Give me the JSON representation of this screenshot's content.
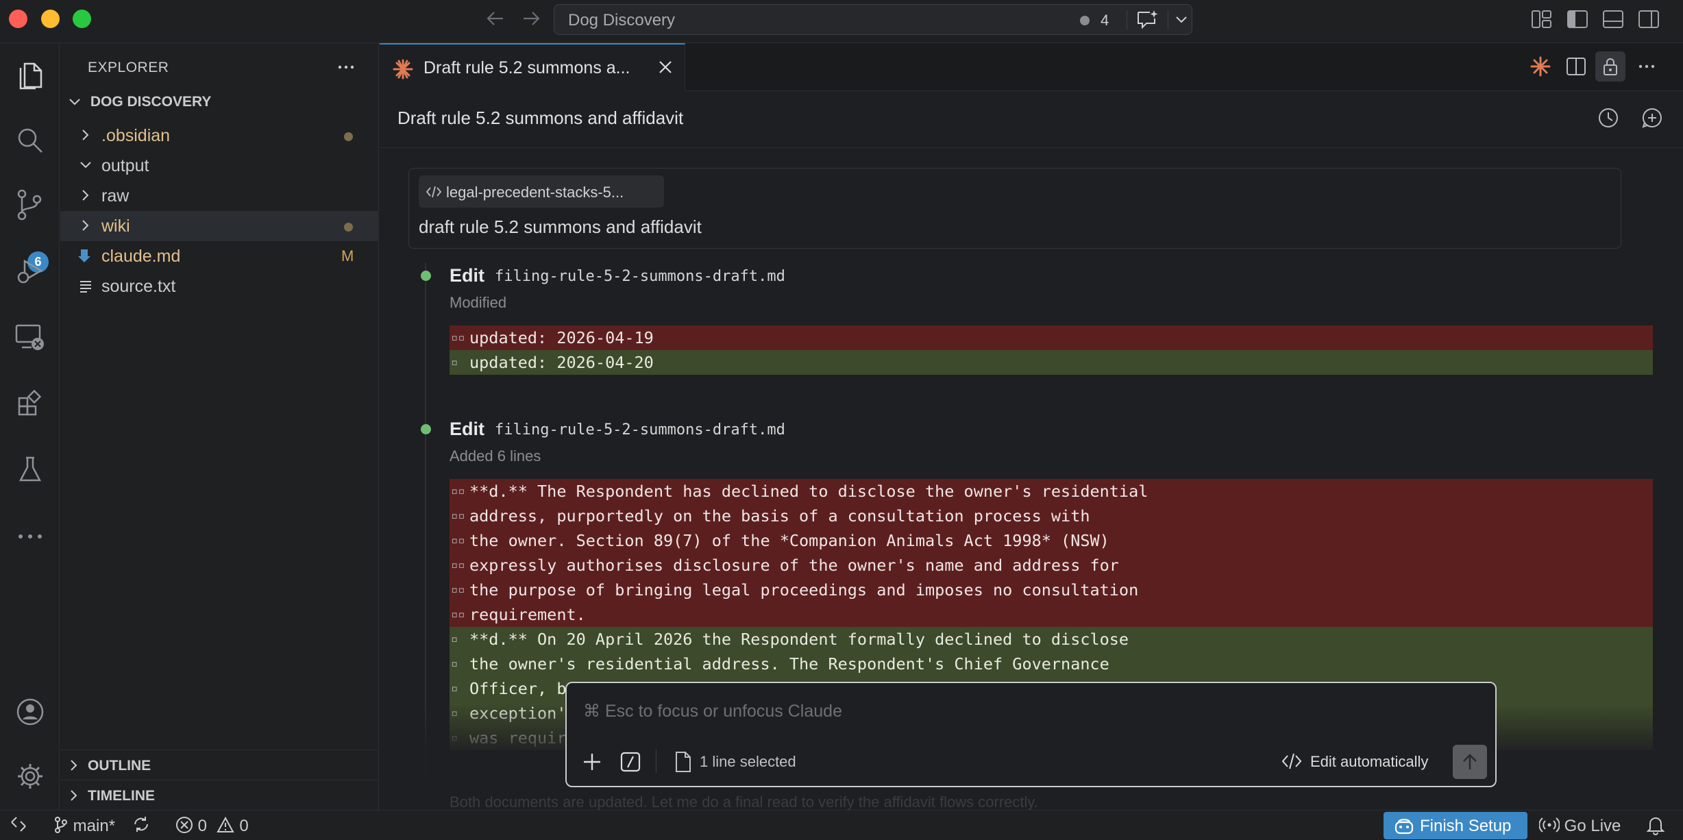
{
  "window": {
    "title": "Dog Discovery",
    "pending_count": "4"
  },
  "explorer": {
    "title": "EXPLORER",
    "workspace": "DOG DISCOVERY",
    "items": [
      {
        "label": ".obsidian",
        "type": "folder",
        "expanded": false,
        "color": "#e2c08d",
        "marker": "dot"
      },
      {
        "label": "output",
        "type": "folder",
        "expanded": true,
        "color": "#cccccc",
        "marker": ""
      },
      {
        "label": "raw",
        "type": "folder",
        "expanded": false,
        "color": "#cccccc",
        "marker": ""
      },
      {
        "label": "wiki",
        "type": "folder",
        "expanded": false,
        "color": "#e2c08d",
        "marker": "dot"
      },
      {
        "label": "claude.md",
        "type": "file",
        "color": "#e2c08d",
        "marker": "M"
      },
      {
        "label": "source.txt",
        "type": "file",
        "color": "#cccccc",
        "marker": ""
      }
    ],
    "outline_label": "OUTLINE",
    "timeline_label": "TIMELINE"
  },
  "activity_badge": "6",
  "tab": {
    "label": "Draft rule 5.2 summons a..."
  },
  "panel": {
    "title": "Draft rule 5.2 summons and affidavit",
    "context_chip": "legal-precedent-stacks-5...",
    "prompt": "draft rule 5.2 summons and affidavit"
  },
  "edits": [
    {
      "title": "Edit",
      "file": "filing-rule-5-2-summons-draft.md",
      "summary": "Modified",
      "lines": [
        {
          "kind": "del",
          "gutter": "▫▫",
          "text": "updated: 2026-04-19"
        },
        {
          "kind": "add",
          "gutter": "▫",
          "text": "updated: 2026-04-20"
        }
      ]
    },
    {
      "title": "Edit",
      "file": "filing-rule-5-2-summons-draft.md",
      "summary": "Added 6 lines",
      "lines": [
        {
          "kind": "del",
          "gutter": "▫▫",
          "text": "**d.** The Respondent has declined to disclose the owner's residential"
        },
        {
          "kind": "del",
          "gutter": "▫▫",
          "text": "address, purportedly on the basis of a consultation process with"
        },
        {
          "kind": "del",
          "gutter": "▫▫",
          "text": "the owner. Section 89(7) of the *Companion Animals Act 1998* (NSW)"
        },
        {
          "kind": "del",
          "gutter": "▫▫",
          "text": "expressly authorises disclosure of the owner's name and address for"
        },
        {
          "kind": "del",
          "gutter": "▫▫",
          "text": "the purpose of bringing legal proceedings and imposes no consultation"
        },
        {
          "kind": "del",
          "gutter": "▫▫",
          "text": "requirement."
        },
        {
          "kind": "add",
          "gutter": "▫",
          "text": "**d.** On 20 April 2026 the Respondent formally declined to disclose"
        },
        {
          "kind": "add",
          "gutter": "▫",
          "text": "the owner's residential address. The Respondent's Chief Governance"
        },
        {
          "kind": "add",
          "gutter": "▫",
          "text": "Officer, b"
        },
        {
          "kind": "add",
          "gutter": "▫",
          "text": "exception'"
        },
        {
          "kind": "add",
          "gutter": "▫",
          "text": "was requir"
        }
      ]
    }
  ],
  "faded_message": "Both documents are updated. Let me do a final read to verify the affidavit flows correctly.",
  "chat_input": {
    "placeholder": "⌘ Esc to focus or unfocus Claude",
    "selection": "1 line selected",
    "mode": "Edit automatically"
  },
  "status": {
    "branch": "main*",
    "errors": "0",
    "warnings": "0",
    "finish_setup": "Finish Setup",
    "go_live": "Go Live"
  },
  "colors": {
    "accent": "#3a88c6",
    "added_dot": "#6fbf73",
    "deleted_bg": "#5c1f1f",
    "added_bg": "#3d4a2b",
    "claude_orange": "#e07b53"
  }
}
